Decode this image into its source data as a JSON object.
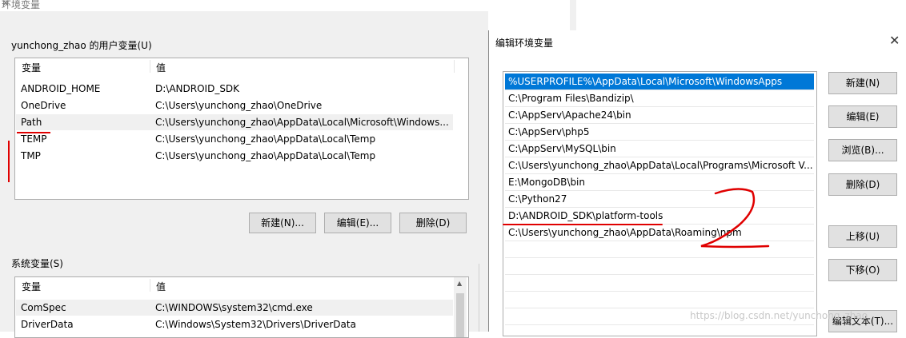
{
  "left_window": {
    "title": "环境变量",
    "close": "✕",
    "user_group": "yunchong_zhao 的用户变量(U)",
    "user_table": {
      "headers": [
        "变量",
        "值"
      ],
      "rows": [
        {
          "name": "ANDROID_HOME",
          "value": "D:\\ANDROID_SDK"
        },
        {
          "name": "OneDrive",
          "value": "C:\\Users\\yunchong_zhao\\OneDrive"
        },
        {
          "name": "Path",
          "value": "C:\\Users\\yunchong_zhao\\AppData\\Local\\Microsoft\\Windows..."
        },
        {
          "name": "TEMP",
          "value": "C:\\Users\\yunchong_zhao\\AppData\\Local\\Temp"
        },
        {
          "name": "TMP",
          "value": "C:\\Users\\yunchong_zhao\\AppData\\Local\\Temp"
        }
      ]
    },
    "user_buttons": {
      "new": "新建(N)...",
      "edit": "编辑(E)...",
      "delete": "删除(D)"
    },
    "system_group": "系统变量(S)",
    "system_table": {
      "headers": [
        "变量",
        "值"
      ],
      "rows": [
        {
          "name": "ComSpec",
          "value": "C:\\WINDOWS\\system32\\cmd.exe"
        },
        {
          "name": "DriverData",
          "value": "C:\\Windows\\System32\\Drivers\\DriverData"
        }
      ]
    }
  },
  "edit_dialog": {
    "title": "编辑环境变量",
    "close": "✕",
    "paths": [
      "%USERPROFILE%\\AppData\\Local\\Microsoft\\WindowsApps",
      "C:\\Program Files\\Bandizip\\",
      "C:\\AppServ\\Apache24\\bin",
      "C:\\AppServ\\php5",
      "C:\\AppServ\\MySQL\\bin",
      "C:\\Users\\yunchong_zhao\\AppData\\Local\\Programs\\Microsoft V...",
      "E:\\MongoDB\\bin",
      "C:\\Python27",
      "D:\\ANDROID_SDK\\platform-tools",
      "C:\\Users\\yunchong_zhao\\AppData\\Roaming\\npm"
    ],
    "buttons": {
      "new": "新建(N)",
      "edit": "编辑(E)",
      "browse": "浏览(B)...",
      "delete": "删除(D)",
      "move_up": "上移(U)",
      "move_down": "下移(O)",
      "edit_text": "编辑文本(T)..."
    }
  },
  "annotation": {
    "handwritten_number": "2"
  },
  "watermark": "https://blog.csdn.net/yunchong_zhao",
  "colors": {
    "selection": "#0078d7",
    "annotation_red": "#e00000",
    "window_bg": "#f0f0f0"
  }
}
